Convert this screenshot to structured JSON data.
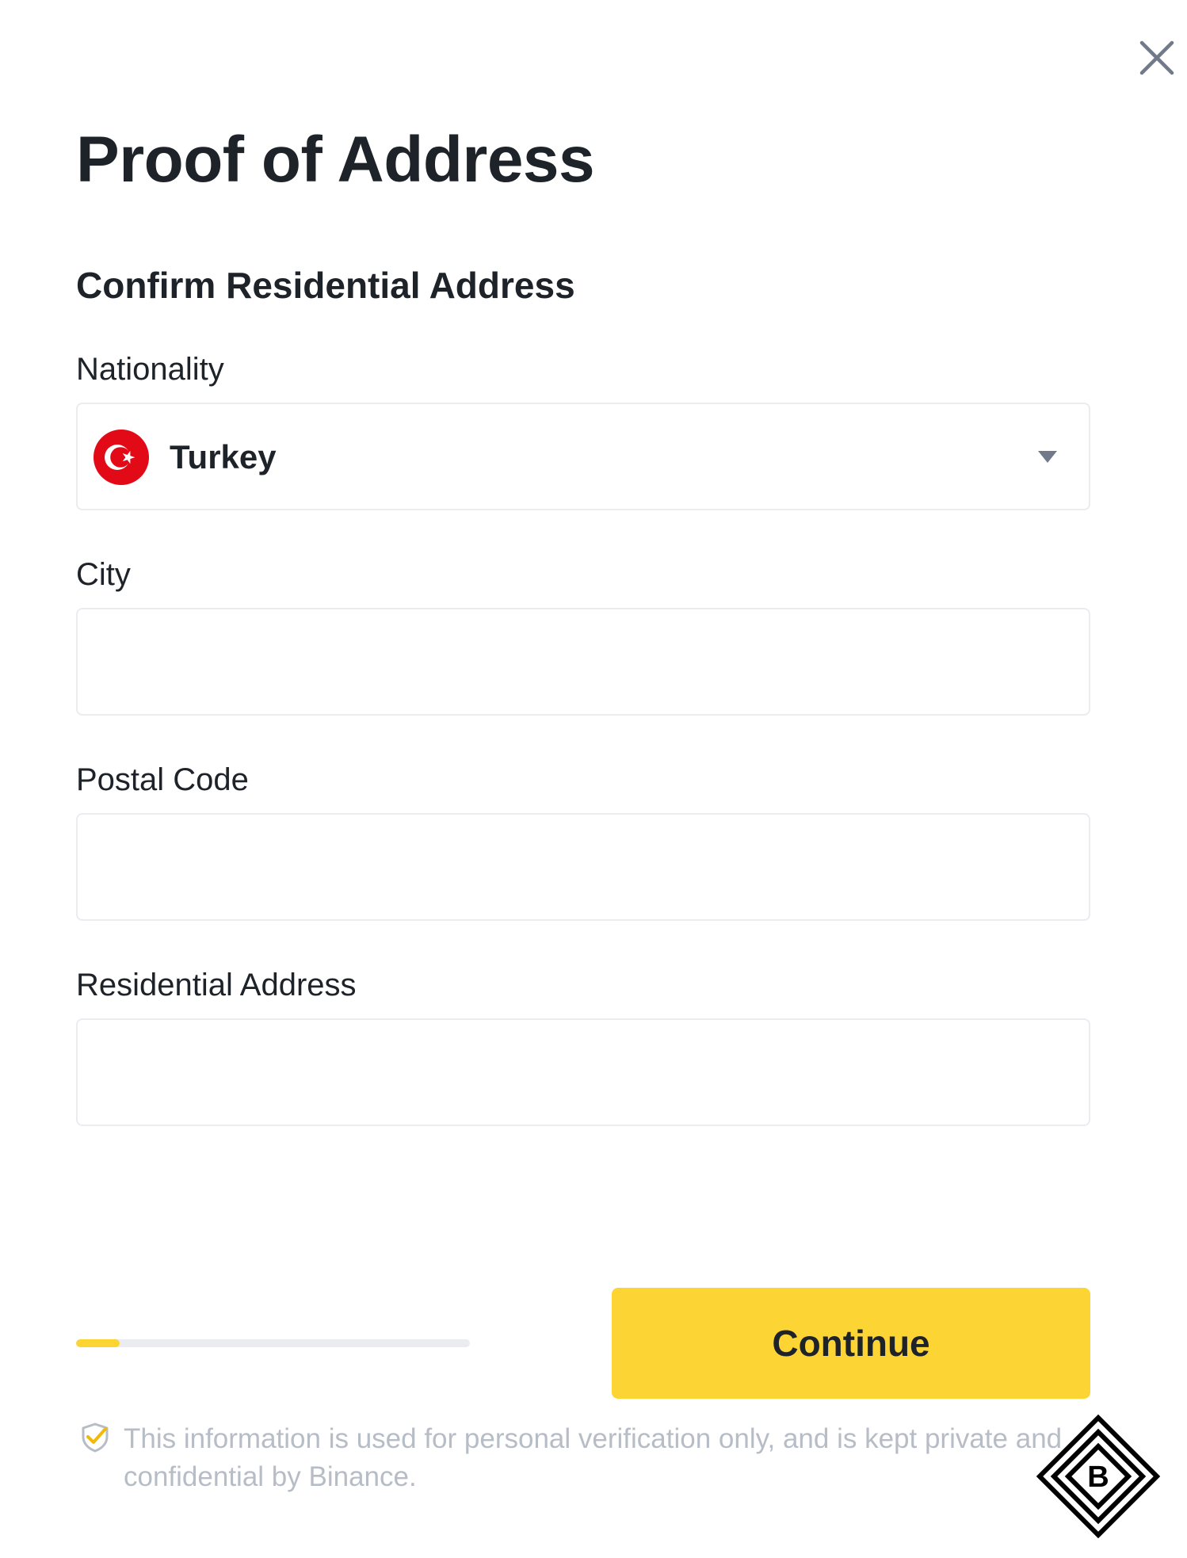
{
  "header": {
    "close_icon": "close-icon",
    "title": "Proof of Address"
  },
  "form": {
    "section_title": "Confirm Residential Address",
    "nationality": {
      "label": "Nationality",
      "value": "Turkey",
      "flag_icon": "turkey-flag-icon",
      "dropdown_icon": "caret-down-icon"
    },
    "city": {
      "label": "City",
      "value": "",
      "placeholder": ""
    },
    "postal_code": {
      "label": "Postal Code",
      "value": "",
      "placeholder": ""
    },
    "residential_address": {
      "label": "Residential Address",
      "value": "",
      "placeholder": ""
    }
  },
  "footer": {
    "progress_fraction": 0.11,
    "continue_label": "Continue",
    "notice_icon": "shield-check-icon",
    "notice_text": "This information is used for personal verification only, and is kept private and confidential by Binance.",
    "watermark_icon": "binance-b-logo-icon"
  },
  "colors": {
    "accent": "#FCD535",
    "text_primary": "#1E2329",
    "text_muted": "#B7BDC6",
    "border": "#EAECEF",
    "flag_red": "#E30A17"
  }
}
